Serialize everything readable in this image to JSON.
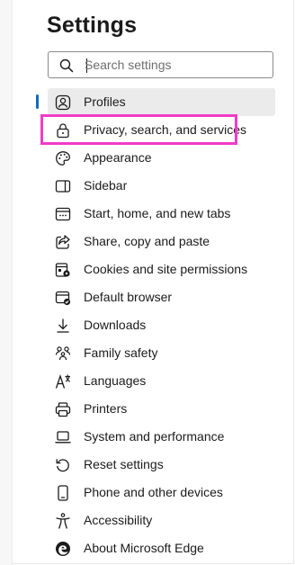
{
  "header": {
    "title": "Settings"
  },
  "search": {
    "placeholder": "Search settings",
    "value": ""
  },
  "nav": {
    "items": [
      {
        "label": "Profiles",
        "icon": "profile-icon",
        "selected": true
      },
      {
        "label": "Privacy, search, and services",
        "icon": "lock-icon",
        "highlighted": true
      },
      {
        "label": "Appearance",
        "icon": "palette-icon"
      },
      {
        "label": "Sidebar",
        "icon": "sidebar-icon"
      },
      {
        "label": "Start, home, and new tabs",
        "icon": "home-tabs-icon"
      },
      {
        "label": "Share, copy and paste",
        "icon": "share-icon"
      },
      {
        "label": "Cookies and site permissions",
        "icon": "cookies-permissions-icon"
      },
      {
        "label": "Default browser",
        "icon": "default-browser-icon"
      },
      {
        "label": "Downloads",
        "icon": "download-icon"
      },
      {
        "label": "Family safety",
        "icon": "family-icon"
      },
      {
        "label": "Languages",
        "icon": "languages-icon"
      },
      {
        "label": "Printers",
        "icon": "printer-icon"
      },
      {
        "label": "System and performance",
        "icon": "laptop-icon"
      },
      {
        "label": "Reset settings",
        "icon": "reset-icon"
      },
      {
        "label": "Phone and other devices",
        "icon": "phone-icon"
      },
      {
        "label": "Accessibility",
        "icon": "accessibility-icon"
      },
      {
        "label": "About Microsoft Edge",
        "icon": "edge-logo-icon"
      }
    ]
  },
  "colors": {
    "accent": "#0f6cbd",
    "highlight_box": "#f03cc8",
    "selected_bg": "#ebebeb"
  }
}
